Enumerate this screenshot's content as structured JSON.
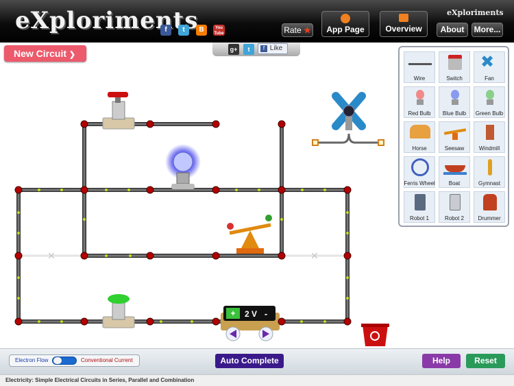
{
  "header": {
    "logo_text": "eXploriments",
    "small_brand": "eXploriments",
    "rate_label": "Rate",
    "app_page_label": "App Page",
    "overview_label": "Overview",
    "about_label": "About",
    "more_label": "More...",
    "social_icons": [
      "facebook-icon",
      "twitter-icon",
      "blogger-icon",
      "youtube-icon"
    ],
    "youtube_text": "You Tube"
  },
  "new_circuit_label": "New Circuit",
  "share": {
    "like_label": "Like",
    "gplus": "g+"
  },
  "palette": {
    "items": [
      {
        "label": "Wire",
        "icon": "wire-icon"
      },
      {
        "label": "Switch",
        "icon": "switch-icon"
      },
      {
        "label": "Fan",
        "icon": "fan-icon"
      },
      {
        "label": "Red Bulb",
        "icon": "red-bulb-icon"
      },
      {
        "label": "Blue Bulb",
        "icon": "blue-bulb-icon"
      },
      {
        "label": "Green Bulb",
        "icon": "green-bulb-icon"
      },
      {
        "label": "Horse",
        "icon": "horse-icon"
      },
      {
        "label": "Seesaw",
        "icon": "seesaw-icon"
      },
      {
        "label": "Windmill",
        "icon": "windmill-icon"
      },
      {
        "label": "Ferris Wheel",
        "icon": "ferris-wheel-icon"
      },
      {
        "label": "Boat",
        "icon": "boat-icon"
      },
      {
        "label": "Gymnast",
        "icon": "gymnast-icon"
      },
      {
        "label": "Robot 1",
        "icon": "robot-1-icon"
      },
      {
        "label": "Robot 2",
        "icon": "robot-2-icon"
      },
      {
        "label": "Drummer",
        "icon": "drummer-icon"
      }
    ]
  },
  "board": {
    "battery_label": "2 V",
    "battery_plus": "+",
    "battery_minus": "-"
  },
  "controls": {
    "electron_flow_label": "Electron Flow",
    "conventional_current_label": "Conventional Current",
    "auto_complete_label": "Auto Complete",
    "help_label": "Help",
    "reset_label": "Reset"
  },
  "footer_text": "Electricity: Simple Electrical Circuits in Series, Parallel and Combination",
  "colors": {
    "accent_red": "#ec5a6c",
    "auto_complete": "#3a1a8a",
    "help": "#8a3aa8",
    "reset": "#2a9a5a",
    "node": "#b30000",
    "current_dot": "#c8e020"
  }
}
